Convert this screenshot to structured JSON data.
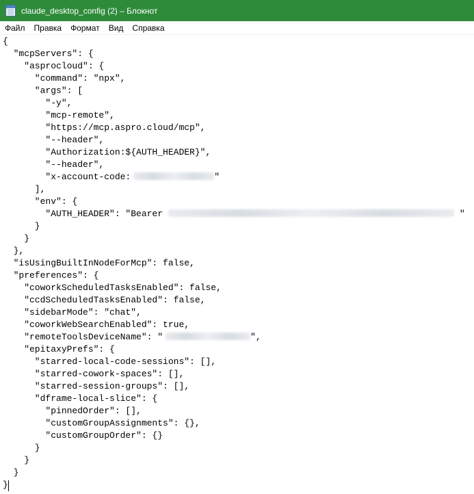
{
  "window": {
    "title": "claude_desktop_config (2) – Блокнот",
    "icon": "notepad-icon"
  },
  "menu": [
    "Файл",
    "Правка",
    "Формат",
    "Вид",
    "Справка"
  ],
  "document": {
    "lines": [
      "{",
      "  \"mcpServers\": {",
      "    \"asprocloud\": {",
      "      \"command\": \"npx\",",
      "      \"args\": [",
      "        \"-y\",",
      "        \"mcp-remote\",",
      "        \"https://mcp.aspro.cloud/mcp\",",
      "        \"--header\",",
      "        \"Authorization:${AUTH_HEADER}\",",
      "        \"--header\",",
      "        \"x-account-code:",
      "      ],",
      "      \"env\": {",
      "        \"AUTH_HEADER\": \"Bearer",
      "      }",
      "    }",
      "  },",
      "  \"isUsingBuiltInNodeForMcp\": false,",
      "  \"preferences\": {",
      "    \"coworkScheduledTasksEnabled\": false,",
      "    \"ccdScheduledTasksEnabled\": false,",
      "    \"sidebarMode\": \"chat\",",
      "    \"coworkWebSearchEnabled\": true,",
      "    \"remoteToolsDeviceName\": \"",
      "    \"epitaxyPrefs\": {",
      "      \"starred-local-code-sessions\": [],",
      "      \"starred-cowork-spaces\": [],",
      "      \"starred-session-groups\": [],",
      "      \"dframe-local-slice\": {",
      "        \"pinnedOrder\": [],",
      "        \"customGroupAssignments\": {},",
      "        \"customGroupOrder\": {}",
      "      }",
      "    }",
      "  }",
      "}"
    ],
    "suffixes": {
      "11": "\"",
      "14": " \"",
      "24": "\","
    }
  }
}
